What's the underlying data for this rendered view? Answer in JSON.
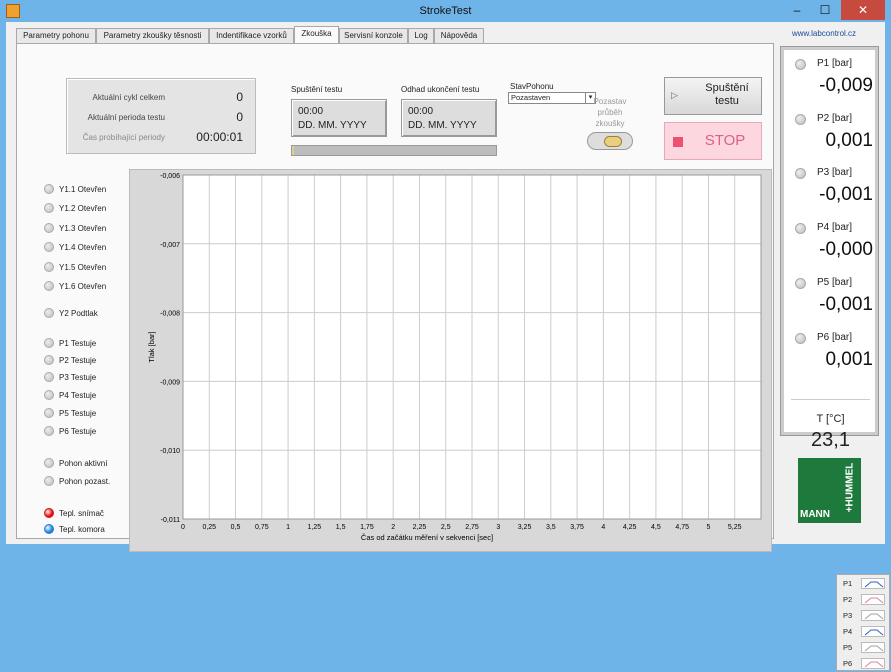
{
  "window": {
    "title": "StrokeTest",
    "min": "–",
    "max": "☐",
    "close": "✕"
  },
  "tabs": [
    "Parametry pohonu",
    "Parametry zkoušky těsnosti",
    "Indentifikace vzorků",
    "Zkouška",
    "Servisní konzole",
    "Log",
    "Nápověda"
  ],
  "active_tab": "Zkouška",
  "url": "www.labcontrol.cz",
  "counters": {
    "cycles_label": "Aktuální cykl celkem",
    "cycles_value": "0",
    "period_label": "Aktuální perioda testu",
    "period_value": "0",
    "time_label": "Čas probíhající periody",
    "time_value": "00:00:01"
  },
  "start_time": {
    "label": "Spuštění testu",
    "time": "00:00",
    "date": "DD. MM. YYYY"
  },
  "end_time": {
    "label": "Odhad ukončení testu",
    "time": "00:00",
    "date": "DD. MM. YYYY"
  },
  "progress": 0.01,
  "stav": {
    "label": "StavPohonu",
    "value": "Pozastaven"
  },
  "pause_label": "Pozastav průběh zkoušky",
  "buttons": {
    "start": "Spuštění testu",
    "stop": "STOP"
  },
  "indicators": [
    {
      "label": "Y1.1 Otevřen",
      "on": false
    },
    {
      "label": "Y1.2 Otevřen",
      "on": false
    },
    {
      "label": "Y1.3 Otevřen",
      "on": false
    },
    {
      "label": "Y1.4 Otevřen",
      "on": false
    },
    {
      "label": "Y1.5 Otevřen",
      "on": false
    },
    {
      "label": "Y1.6 Otevřen",
      "on": false
    },
    {
      "label": "Y2 Podtlak",
      "on": false
    },
    {
      "label": "P1 Testuje",
      "on": false
    },
    {
      "label": "P2 Testuje",
      "on": false
    },
    {
      "label": "P3 Testuje",
      "on": false
    },
    {
      "label": "P4 Testuje",
      "on": false
    },
    {
      "label": "P5 Testuje",
      "on": false
    },
    {
      "label": "P6 Testuje",
      "on": false
    },
    {
      "label": "Pohon aktivní",
      "on": false
    },
    {
      "label": "Pohon pozast.",
      "on": false
    },
    {
      "label": "Tepl. snímač",
      "on": true,
      "color": "#e01010"
    },
    {
      "label": "Tepl. komora",
      "on": true,
      "color": "#2080e0"
    }
  ],
  "chart_data": {
    "type": "line",
    "xlabel": "Čas od začátku měření v sekvenci [sec]",
    "ylabel": "Tlak [bar]",
    "xlim": [
      0,
      5.5
    ],
    "ylim": [
      -0.011,
      -0.006
    ],
    "x_ticks": [
      "0",
      "0,25",
      "0,5",
      "0,75",
      "1",
      "1,25",
      "1,5",
      "1,75",
      "2",
      "2,25",
      "2,5",
      "2,75",
      "3",
      "3,25",
      "3,5",
      "3,75",
      "4",
      "4,25",
      "4,5",
      "4,75",
      "5",
      "5,25"
    ],
    "y_ticks": [
      "-0,006",
      "-0,007",
      "-0,008",
      "-0,009",
      "-0,010",
      "-0,011"
    ],
    "grid": true,
    "legend_position": "bottom-right",
    "series": [
      {
        "name": "P1",
        "values": [],
        "color": "#3060c0"
      },
      {
        "name": "P2",
        "values": [],
        "color": "#e08090"
      },
      {
        "name": "P3",
        "values": [],
        "color": "#a0a0a0"
      },
      {
        "name": "P4",
        "values": [],
        "color": "#3060c0"
      },
      {
        "name": "P5",
        "values": [],
        "color": "#a0a0a0"
      },
      {
        "name": "P6",
        "values": [],
        "color": "#e08090"
      }
    ]
  },
  "pressures": [
    {
      "label": "P1 [bar]",
      "value": "-0,009"
    },
    {
      "label": "P2 [bar]",
      "value": "0,001"
    },
    {
      "label": "P3 [bar]",
      "value": "-0,001"
    },
    {
      "label": "P4 [bar]",
      "value": "-0,000"
    },
    {
      "label": "P5 [bar]",
      "value": "-0,001"
    },
    {
      "label": "P6 [bar]",
      "value": "0,001"
    }
  ],
  "temperature": {
    "label": "T [°C]",
    "value": "23,1"
  },
  "logo": {
    "line1": "MANN",
    "line2": "+HUMMEL"
  }
}
